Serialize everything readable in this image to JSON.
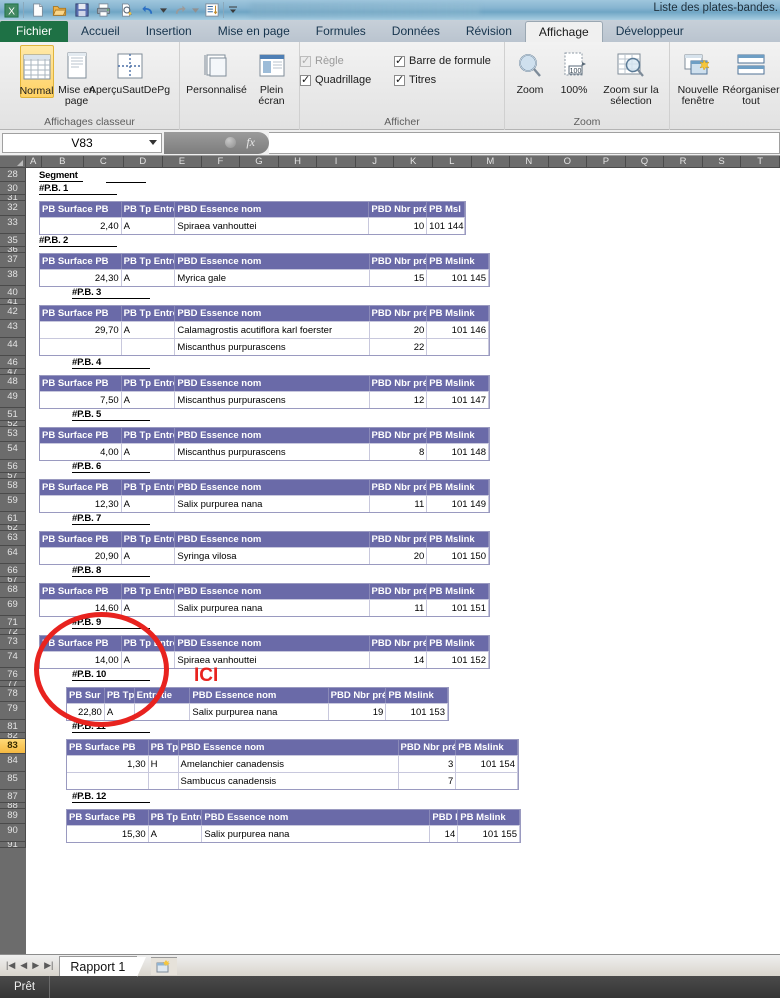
{
  "window": {
    "title": "Liste des plates-bandes.",
    "quick_access": [
      "excel-logo",
      "new-icon",
      "open-icon",
      "save-icon",
      "print-icon",
      "print-preview-icon",
      "undo-icon",
      "undo-dropdown-icon",
      "redo-icon",
      "redo-dropdown-icon",
      "sort-icon",
      "qat-dropdown-icon"
    ]
  },
  "ribbon": {
    "tabs": [
      {
        "label": "Fichier",
        "active": false,
        "file": true
      },
      {
        "label": "Accueil",
        "active": false
      },
      {
        "label": "Insertion",
        "active": false
      },
      {
        "label": "Mise en page",
        "active": false
      },
      {
        "label": "Formules",
        "active": false
      },
      {
        "label": "Données",
        "active": false
      },
      {
        "label": "Révision",
        "active": false
      },
      {
        "label": "Affichage",
        "active": true
      },
      {
        "label": "Développeur",
        "active": false
      }
    ],
    "groups": [
      {
        "title": "Affichages classeur",
        "buttons": [
          {
            "label": "Normal",
            "icon": "normal-view-icon",
            "selected": true
          },
          {
            "label": "Mise en page",
            "icon": "page-layout-icon",
            "selected": false
          },
          {
            "label": "AperçuSautDePg",
            "icon": "page-break-preview-icon",
            "selected": false
          },
          {
            "label": "Personnalisé",
            "icon": "custom-views-icon",
            "selected": false
          },
          {
            "label": "Plein écran",
            "icon": "full-screen-icon",
            "selected": false
          }
        ]
      },
      {
        "title": "Afficher",
        "checkboxes": [
          {
            "label": "Règle",
            "checked": true,
            "disabled": true
          },
          {
            "label": "Barre de formule",
            "checked": true,
            "disabled": false
          },
          {
            "label": "Quadrillage",
            "checked": true,
            "disabled": false
          },
          {
            "label": "Titres",
            "checked": true,
            "disabled": false
          }
        ]
      },
      {
        "title": "Zoom",
        "buttons": [
          {
            "label": "Zoom",
            "icon": "zoom-magnifier-icon",
            "selected": false
          },
          {
            "label": "100%",
            "icon": "zoom-100-icon",
            "selected": false
          },
          {
            "label": "Zoom sur la sélection",
            "icon": "zoom-selection-icon",
            "selected": false
          }
        ]
      },
      {
        "title": "",
        "buttons": [
          {
            "label": "Nouvelle fenêtre",
            "icon": "new-window-icon",
            "selected": false
          },
          {
            "label": "Réorganiser tout",
            "icon": "arrange-all-icon",
            "selected": false
          }
        ]
      }
    ]
  },
  "formula_bar": {
    "name_box": "V83",
    "fx_label": "fx",
    "content": ""
  },
  "grid": {
    "columns": [
      "A",
      "B",
      "C",
      "D",
      "E",
      "F",
      "G",
      "H",
      "I",
      "J",
      "K",
      "L",
      "M",
      "N",
      "O",
      "P",
      "Q",
      "R",
      "S",
      "T"
    ],
    "selected_row": "83",
    "rows": [
      "28",
      "30",
      "31",
      "32",
      "33",
      "35",
      "36",
      "37",
      "38",
      "40",
      "41",
      "42",
      "43",
      "44",
      "46",
      "47",
      "48",
      "49",
      "51",
      "52",
      "53",
      "54",
      "56",
      "57",
      "58",
      "59",
      "61",
      "62",
      "63",
      "64",
      "66",
      "67",
      "68",
      "69",
      "71",
      "72",
      "73",
      "74",
      "76",
      "77",
      "78",
      "79",
      "81",
      "82",
      "83",
      "84",
      "85",
      "87",
      "88",
      "89",
      "90",
      "91"
    ],
    "segment_label": "Segment"
  },
  "report": {
    "headers_full": [
      "PB Surface PB",
      "PB Tp Entretie",
      "PBD Essence nom",
      "PBD Nbr prése",
      "PB Mslink"
    ],
    "sections": [
      {
        "title": "#P.B.  1",
        "headers": [
          "PB Surface PB",
          "PB Tp Entretie",
          "PBD Essence nom",
          "PBD Nbr prése",
          "PB Msl"
        ],
        "rows": [
          {
            "surface": "2,40",
            "type": "A",
            "essence": "Spiraea vanhouttei",
            "nbr": "10",
            "mslink": "101 144"
          }
        ]
      },
      {
        "title": "#P.B.  2",
        "headers": [
          "PB Surface PB",
          "PB Tp Entretie",
          "PBD Essence nom",
          "PBD Nbr prése",
          "PB Mslink"
        ],
        "rows": [
          {
            "surface": "24,30",
            "type": "A",
            "essence": "Myrica gale",
            "nbr": "15",
            "mslink": "101 145"
          }
        ]
      },
      {
        "title": "#P.B.  3",
        "headers": [
          "PB Surface PB",
          "PB Tp Entretie",
          "PBD Essence nom",
          "PBD Nbr prése",
          "PB Mslink"
        ],
        "rows": [
          {
            "surface": "29,70",
            "type": "A",
            "essence": "Calamagrostis acutiflora karl foerster",
            "nbr": "20",
            "mslink": "101 146"
          },
          {
            "surface": "",
            "type": "",
            "essence": "Miscanthus purpurascens",
            "nbr": "22",
            "mslink": ""
          }
        ]
      },
      {
        "title": "#P.B.  4",
        "headers": [
          "PB Surface PB",
          "PB Tp Entretie",
          "PBD Essence nom",
          "PBD Nbr prése",
          "PB Mslink"
        ],
        "rows": [
          {
            "surface": "7,50",
            "type": "A",
            "essence": "Miscanthus purpurascens",
            "nbr": "12",
            "mslink": "101 147"
          }
        ]
      },
      {
        "title": "#P.B.  5",
        "headers": [
          "PB Surface PB",
          "PB Tp Entretie",
          "PBD Essence nom",
          "PBD Nbr prése",
          "PB Mslink"
        ],
        "rows": [
          {
            "surface": "4,00",
            "type": "A",
            "essence": "Miscanthus purpurascens",
            "nbr": "8",
            "mslink": "101 148"
          }
        ]
      },
      {
        "title": "#P.B.  6",
        "headers": [
          "PB Surface PB",
          "PB Tp Entretie",
          "PBD Essence nom",
          "PBD Nbr prése",
          "PB Mslink"
        ],
        "rows": [
          {
            "surface": "12,30",
            "type": "A",
            "essence": "Salix purpurea nana",
            "nbr": "11",
            "mslink": "101 149"
          }
        ]
      },
      {
        "title": "#P.B.  7",
        "headers": [
          "PB Surface PB",
          "PB Tp Entretie",
          "PBD Essence nom",
          "PBD Nbr prése",
          "PB Mslink"
        ],
        "rows": [
          {
            "surface": "20,90",
            "type": "A",
            "essence": "Syringa vilosa",
            "nbr": "20",
            "mslink": "101 150"
          }
        ]
      },
      {
        "title": "#P.B.  8",
        "headers": [
          "PB Surface PB",
          "PB Tp Entretie",
          "PBD Essence nom",
          "PBD Nbr prése",
          "PB Mslink"
        ],
        "rows": [
          {
            "surface": "14,60",
            "type": "A",
            "essence": "Salix purpurea nana",
            "nbr": "11",
            "mslink": "101 151"
          }
        ]
      },
      {
        "title": "#P.B.  9",
        "headers": [
          "PB Surface PB",
          "PB Tp Entretie",
          "PBD Essence nom",
          "PBD Nbr prése",
          "PB Mslink"
        ],
        "rows": [
          {
            "surface": "14,00",
            "type": "A",
            "essence": "Spiraea vanhouttei",
            "nbr": "14",
            "mslink": "101 152"
          }
        ]
      },
      {
        "title": "#P.B.  10",
        "headers": [
          "PB Sur",
          "PB Tp",
          "Entretie",
          "PBD Essence nom",
          "PBD Nbr prése",
          "PB Mslink"
        ],
        "rows": [
          {
            "surface": "22,80",
            "type": "A",
            "essence": "Salix purpurea nana",
            "nbr": "19",
            "mslink": "101 153"
          }
        ]
      },
      {
        "title": "#P.B.  11",
        "headers": [
          "PB Surface PB",
          "PB Tp",
          "PBD Essence nom",
          "PBD Nbr prése",
          "PB Mslink"
        ],
        "rows": [
          {
            "surface": "1,30",
            "type": "H",
            "essence": "Amelanchier canadensis",
            "nbr": "3",
            "mslink": "101 154"
          },
          {
            "surface": "",
            "type": "",
            "essence": "Sambucus canadensis",
            "nbr": "7",
            "mslink": ""
          }
        ]
      },
      {
        "title": "#P.B.  12",
        "headers": [
          "PB Surface PB",
          "PB Tp Entretie",
          "PBD Essence nom",
          "PBD N",
          "PB Mslink"
        ],
        "rows": [
          {
            "surface": "15,30",
            "type": "A",
            "essence": "Salix purpurea nana",
            "nbr": "14",
            "mslink": "101 155"
          }
        ]
      }
    ]
  },
  "annotation": {
    "text": "ICI",
    "color": "#e8231f",
    "shape": "ellipse"
  },
  "sheet_tabs": {
    "tabs": [
      "Rapport 1"
    ],
    "new_sheet_icon": "new-sheet-icon",
    "nav": [
      "first-sheet-icon",
      "prev-sheet-icon",
      "next-sheet-icon",
      "last-sheet-icon"
    ]
  },
  "status_bar": {
    "text": "Prêt"
  }
}
